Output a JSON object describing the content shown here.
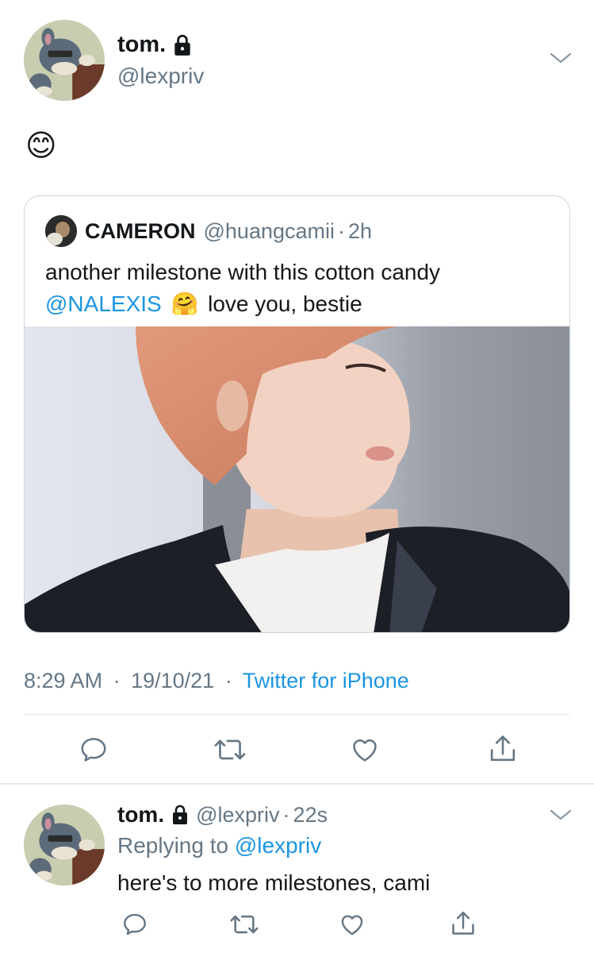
{
  "tweet": {
    "author_name": "tom.",
    "author_handle": "@lexpriv",
    "body": "😊",
    "timestamp": "8:29 AM",
    "date": "19/10/21",
    "source": "Twitter for iPhone",
    "separator": "·"
  },
  "quote": {
    "author_name": "CAMERON",
    "author_handle": "@huangcamii",
    "time": "2h",
    "separator": "·",
    "text_line1": "another milestone with this cotton candy",
    "mention": "@NALEXIS",
    "emoji": "🤗",
    "text_rest": "love you, bestie"
  },
  "reply": {
    "author_name": "tom.",
    "author_handle": "@lexpriv",
    "time": "22s",
    "separator": "·",
    "replying_label": "Replying to",
    "replying_handle": "@lexpriv",
    "body": "here's to more milestones, cami"
  },
  "icons": {
    "lock": "lock-icon",
    "chevron": "chevron-down-icon",
    "reply": "reply-icon",
    "retweet": "retweet-icon",
    "like": "like-icon",
    "share": "share-icon"
  },
  "colors": {
    "link": "#1b95e0",
    "muted": "#657786",
    "text": "#14171a",
    "border": "#e1e8ed"
  }
}
